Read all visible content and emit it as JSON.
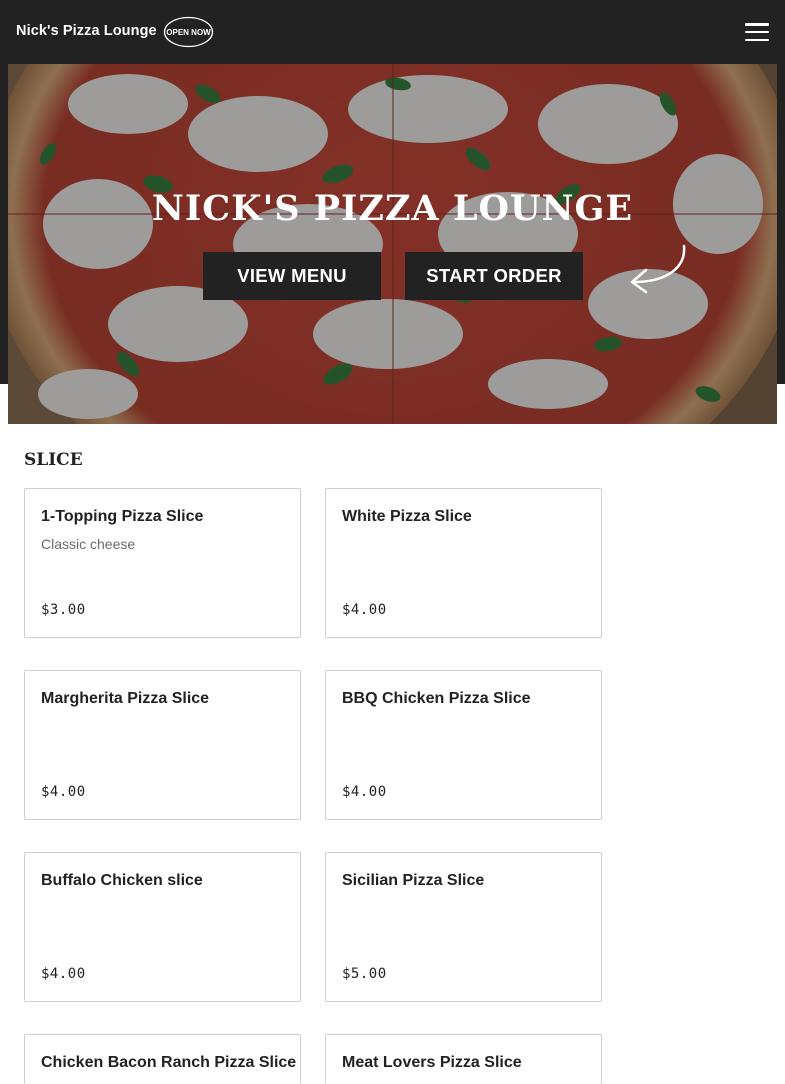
{
  "header": {
    "brand": "Nick's Pizza Lounge",
    "open_badge": "OPEN NOW",
    "menu_icon": "hamburger-menu-icon"
  },
  "hero": {
    "title": "NICK'S PIZZA LOUNGE",
    "view_menu_label": "VIEW MENU",
    "start_order_label": "START ORDER",
    "arrow_icon": "curved-arrow-icon"
  },
  "section": {
    "title": "SLICE"
  },
  "items": [
    {
      "name": "1-Topping Pizza Slice",
      "description": "Classic cheese",
      "price": "$3.00"
    },
    {
      "name": "White Pizza Slice",
      "description": "",
      "price": "$4.00"
    },
    {
      "name": "Margherita Pizza Slice",
      "description": "",
      "price": "$4.00"
    },
    {
      "name": "BBQ Chicken Pizza Slice",
      "description": "",
      "price": "$4.00"
    },
    {
      "name": "Buffalo Chicken slice",
      "description": "",
      "price": "$4.00"
    },
    {
      "name": "Sicilian Pizza Slice",
      "description": "",
      "price": "$5.00"
    },
    {
      "name": "Chicken Bacon Ranch Pizza Slice",
      "description": "",
      "price": ""
    },
    {
      "name": "Meat Lovers Pizza Slice",
      "description": "",
      "price": ""
    }
  ],
  "colors": {
    "header_bg": "#222222",
    "button_bg": "#222222",
    "card_border": "#cfcfcf"
  }
}
